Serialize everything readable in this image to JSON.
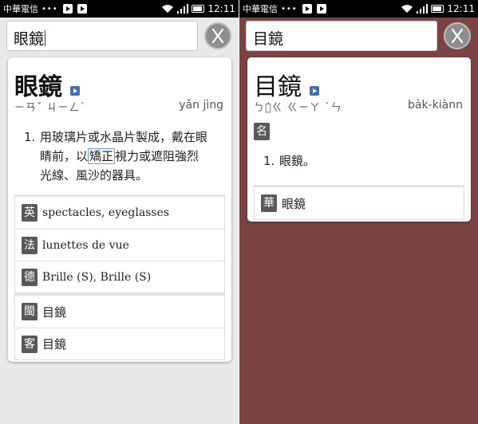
{
  "status": {
    "carrier": "中華電信",
    "dots": "•••",
    "time": "12:11"
  },
  "left": {
    "query": "眼鏡",
    "headword": "眼鏡",
    "bopomofo": "ㄧㄢˇ ㄐㄧㄥˋ",
    "pinyin": "yǎn jìng",
    "definition": {
      "number": "1.",
      "line1": "用玻璃片或水晶片製成，戴在眼",
      "line2_pre": "睛前，以",
      "line2_hl": "矯正",
      "line2_post": "視力或遮阻強烈",
      "line3": "光線、風沙的器具。"
    },
    "translations": [
      {
        "lang": "英",
        "text": "spectacles, eyeglasses"
      },
      {
        "lang": "法",
        "text": "lunettes de vue"
      },
      {
        "lang": "德",
        "text": "Brille (S), Brille (S)"
      }
    ],
    "dialects": [
      {
        "lang": "閩",
        "text": "目鏡"
      },
      {
        "lang": "客",
        "text": "目鏡"
      }
    ]
  },
  "right": {
    "query": "目鏡",
    "headword": "目鏡",
    "phonetic": "ㄅㄚ̍ㄍ ㄍㄧㄚ ˋㄣ",
    "romanization": "ba̍k-kiànn",
    "pos": "名",
    "definition": {
      "number": "1.",
      "text": "眼鏡。"
    },
    "mandarin": {
      "lang": "華",
      "text": "眼鏡"
    }
  },
  "colors": {
    "left_background": "#e9e9e9",
    "right_background": "#7a4444",
    "badge": "#595959",
    "play_icon": "#3f72a8"
  }
}
